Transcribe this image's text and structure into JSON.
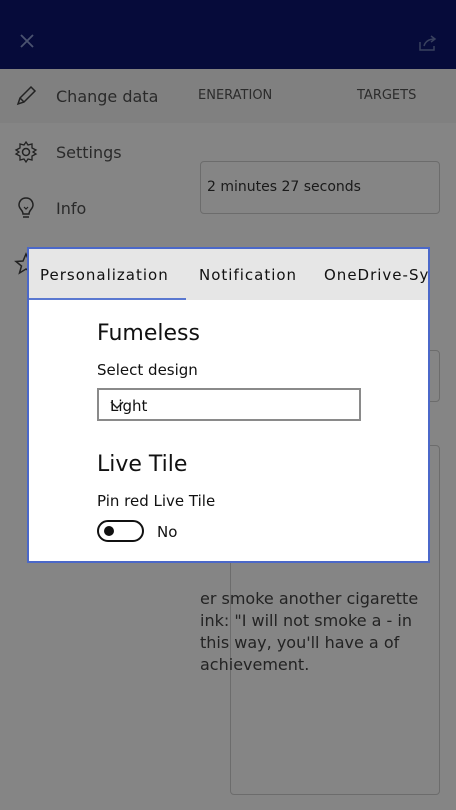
{
  "background": {
    "tabs": [
      "ENERATION",
      "TARGETS"
    ],
    "elapsed_field": "2 minutes 27 seconds",
    "quote": "er smoke another cigarette ink: \"I will not smoke a - in this way, you'll have a of achievement."
  },
  "sidebar": {
    "items": [
      {
        "label": "Change data",
        "icon": "pencil-icon"
      },
      {
        "label": "Settings",
        "icon": "gear-icon"
      },
      {
        "label": "Info",
        "icon": "lightbulb-icon"
      },
      {
        "label": "",
        "icon": "star-icon"
      }
    ]
  },
  "dialog": {
    "tabs": [
      "Personalization",
      "Notification",
      "OneDrive-Sy"
    ],
    "active_tab": "Personalization",
    "section1_title": "Fumeless",
    "select_label": "Select design",
    "select_value": "Light",
    "section2_title": "Live Tile",
    "toggle_label": "Pin red Live Tile",
    "toggle_state": "No"
  },
  "colors": {
    "topbar": "#0d1670",
    "accent": "#4b68c9"
  }
}
